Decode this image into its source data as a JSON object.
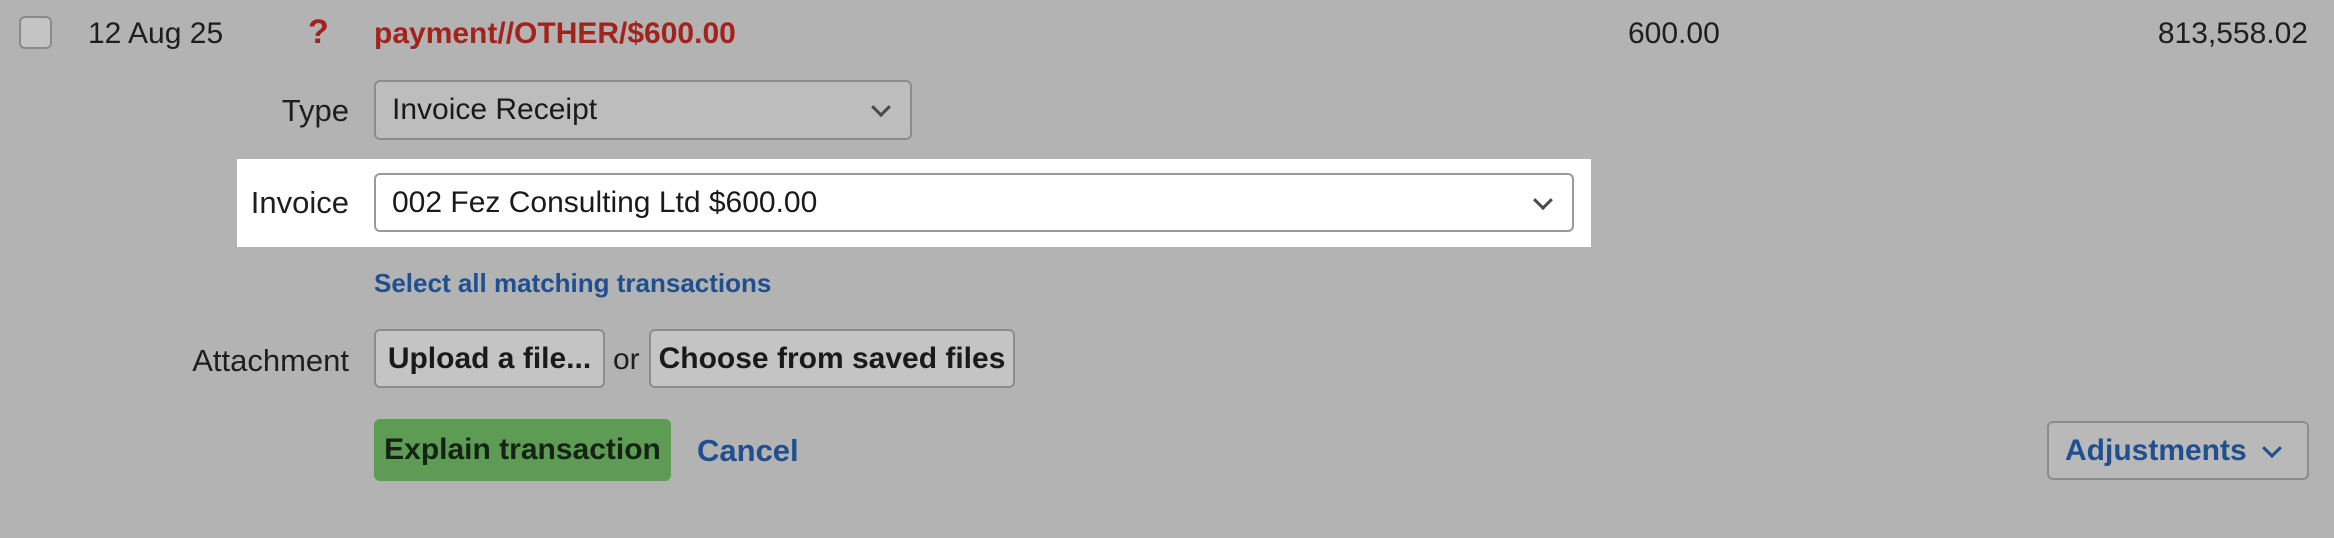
{
  "transaction": {
    "date": "12 Aug 25",
    "status_icon": "?",
    "description": "payment//OTHER/$600.00",
    "amount": "600.00",
    "balance": "813,558.02"
  },
  "form": {
    "type_label": "Type",
    "type_value": "Invoice Receipt",
    "invoice_label": "Invoice",
    "invoice_value": "002 Fez Consulting Ltd $600.00",
    "select_all_link": "Select all matching transactions",
    "attachment_label": "Attachment",
    "upload_button": "Upload a file...",
    "or_text": "or",
    "choose_button": "Choose from saved files",
    "explain_button": "Explain transaction",
    "cancel_link": "Cancel",
    "adjustments_button": "Adjustments"
  },
  "colors": {
    "background": "#b3b3b3",
    "unexplained_red": "#a3231c",
    "link_blue": "#1f4f8f",
    "primary_green": "#5e9b55",
    "highlight": "#ffffff"
  },
  "icons": {
    "status": "question-mark-icon",
    "dropdown": "chevron-down-icon"
  }
}
